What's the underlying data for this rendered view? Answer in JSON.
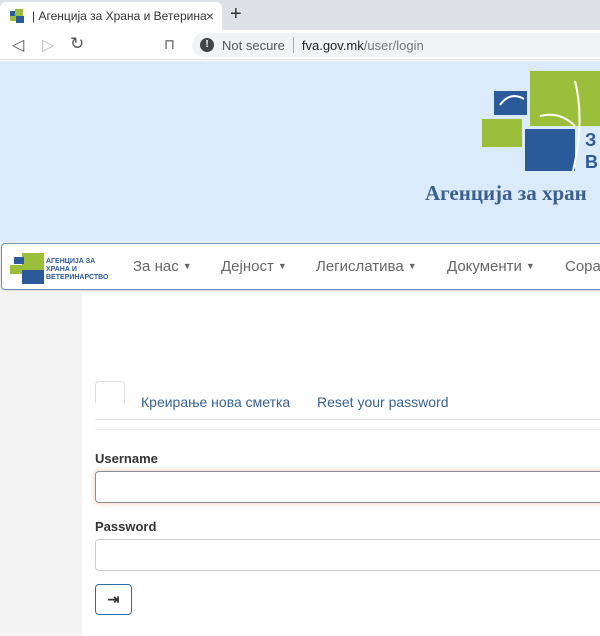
{
  "browser": {
    "tab_title": "| Агенција за Храна и Ветерина",
    "close_icon": "×",
    "new_tab_icon": "+",
    "not_secure": "Not secure",
    "url_domain": "fva.gov.mk",
    "url_path": "/user/login"
  },
  "banner": {
    "title": "Агенција за хран",
    "logo_letters": "З В"
  },
  "navbar": {
    "logo_text": "АГЕНЦИЈА ЗА ХРАНА И ВЕТЕРИНАРСТВО",
    "items": [
      {
        "label": "За нас"
      },
      {
        "label": "Дејност"
      },
      {
        "label": "Легислатива"
      },
      {
        "label": "Документи"
      },
      {
        "label": "Сора"
      }
    ],
    "caret": "▼"
  },
  "login": {
    "create_account": "Креирање нова сметка",
    "reset_password": "Reset your password",
    "username_label": "Username",
    "username_value": "",
    "password_label": "Password",
    "password_value": "",
    "submit_icon": "sign-in-icon"
  },
  "colors": {
    "banner": "#dcebfb",
    "brand_blue": "#2b5a9a",
    "brand_green": "#9cbf3b",
    "link": "#3a6291"
  }
}
